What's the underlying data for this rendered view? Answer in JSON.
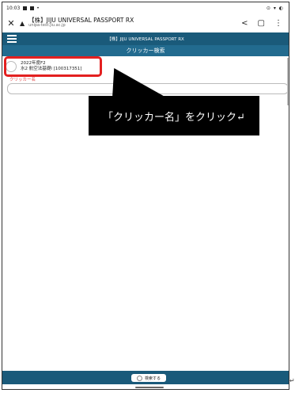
{
  "statusbar": {
    "time": "10:03",
    "dot": "•",
    "right": "⊙ ▾ ◐"
  },
  "browser": {
    "close": "✕",
    "tri": "▲",
    "title": "【株】JIJU UNIVERSAL PASSPORT RX",
    "url": "unipa-test.jiu.ac.jp",
    "share": "<",
    "tab": "▢",
    "more": "⋮"
  },
  "app": {
    "title": "【株】JIJU UNIVERSAL PASSPORT RX",
    "subtitle": "クリッカー検索"
  },
  "course": {
    "line1": "2022年度F2",
    "line2": "水2 航空法基礎I [100317351]"
  },
  "clicker": {
    "label": "クリッカー名"
  },
  "callout": {
    "text": "「クリッカー名」をクリック↵"
  },
  "bottom": {
    "search_label": "検索する"
  },
  "margin": {
    "mark": "↵"
  }
}
